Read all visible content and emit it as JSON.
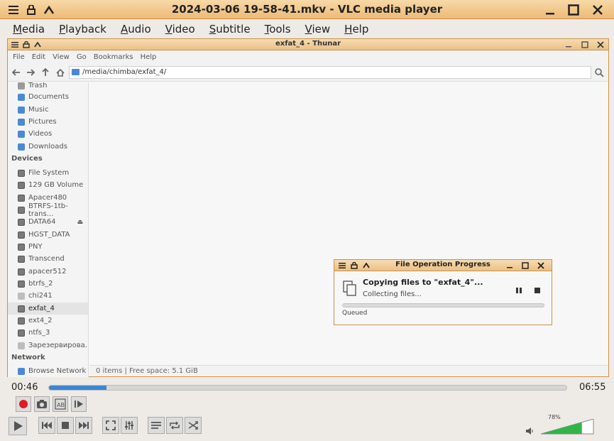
{
  "vlc": {
    "title": "2024-03-06 19-58-41.mkv - VLC media player",
    "menu": [
      "Media",
      "Playback",
      "Audio",
      "Video",
      "Subtitle",
      "Tools",
      "View",
      "Help"
    ],
    "elapsed": "00:46",
    "total": "06:55",
    "seek_fraction": 0.111,
    "volume_label": "78%",
    "volume_fraction": 0.78,
    "colors": {
      "accent": "#3a87d6",
      "record": "#e01b24",
      "titlebar": "#eeba76"
    }
  },
  "thunar": {
    "title": "exfat_4 - Thunar",
    "menu": [
      "File",
      "Edit",
      "View",
      "Go",
      "Bookmarks",
      "Help"
    ],
    "path": "/media/chimba/exfat_4/",
    "places": [
      "Trash",
      "Documents",
      "Music",
      "Pictures",
      "Videos",
      "Downloads"
    ],
    "devices_heading": "Devices",
    "devices": [
      "File System",
      "129 GB Volume",
      "Apacer480",
      "BTRFS-1tb-trans...",
      "DATA64",
      "HGST_DATA",
      "PNY",
      "Transcend",
      "apacer512",
      "btrfs_2",
      "chi241",
      "exfat_4",
      "ext4_2",
      "ntfs_3",
      "Зарезервирова..."
    ],
    "network_heading": "Network",
    "network": [
      "Browse Network"
    ],
    "status": "0 items  |  Free space: 5.1 GiB"
  },
  "fileop": {
    "title": "File Operation Progress",
    "heading": "Copying files to \"exfat_4\"...",
    "sub": "Collecting files...",
    "queued": "Queued"
  }
}
